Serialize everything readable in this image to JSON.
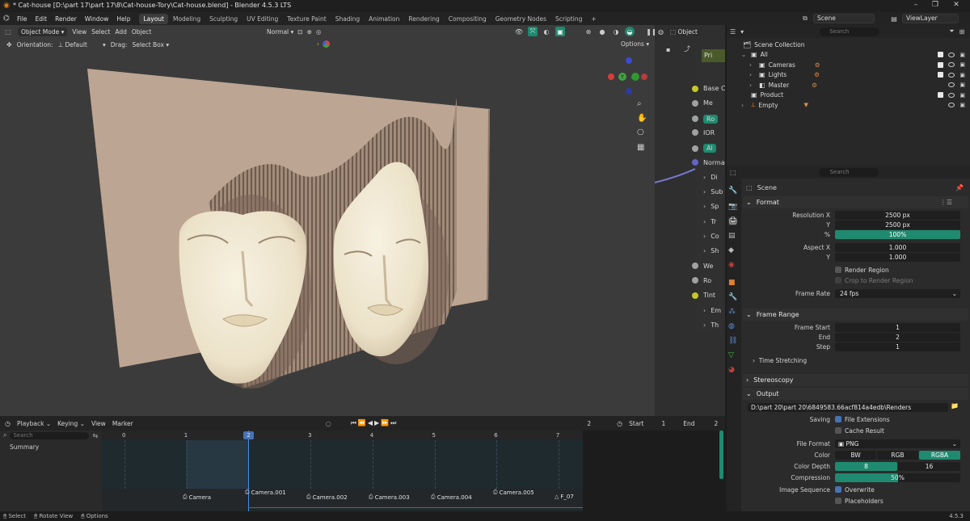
{
  "window": {
    "title": "* Cat-house [D:\\part 17\\part 17\\8\\Cat-house-Tory\\Cat-house.blend] - Blender 4.5.3 LTS",
    "minimize": "–",
    "maximize": "❐",
    "close": "✕"
  },
  "menu": [
    "File",
    "Edit",
    "Render",
    "Window",
    "Help"
  ],
  "workspaces": [
    "Layout",
    "Modeling",
    "Sculpting",
    "UV Editing",
    "Texture Paint",
    "Shading",
    "Animation",
    "Rendering",
    "Compositing",
    "Geometry Nodes",
    "Scripting"
  ],
  "workspace_add": "+",
  "scene": {
    "label": "Scene",
    "view_layer": "ViewLayer"
  },
  "viewport": {
    "mode": "Object Mode",
    "menus": [
      "View",
      "Select",
      "Add",
      "Object"
    ],
    "orientation_label": "Orientation:",
    "orientation_value": "Default",
    "drag_label": "Drag:",
    "drag_value": "Select Box",
    "shading_mode": "Normal",
    "options": "Options"
  },
  "node_editor": {
    "mode": "Object",
    "header_label": "Pri",
    "rows": [
      "Base C",
      "Me",
      "Ro",
      "IOR",
      "Al",
      "Norma",
      "Di",
      "Sub",
      "Sp",
      "Tr",
      "Co",
      "Sh",
      "We",
      "Ro",
      "Tint",
      "Em",
      "Th"
    ]
  },
  "outliner": {
    "search_placeholder": "Search",
    "items": [
      {
        "label": "Scene Collection",
        "indent": 0
      },
      {
        "label": "All",
        "indent": 1
      },
      {
        "label": "Cameras",
        "indent": 2
      },
      {
        "label": "Lights",
        "indent": 2
      },
      {
        "label": "Master",
        "indent": 2
      },
      {
        "label": "Product",
        "indent": 1
      },
      {
        "label": "Empty",
        "indent": 1
      }
    ]
  },
  "properties": {
    "search_placeholder": "Search",
    "context": "Scene",
    "format": {
      "title": "Format",
      "res_x_label": "Resolution X",
      "res_x": "2500 px",
      "res_y_label": "Y",
      "res_y": "2500 px",
      "percent_label": "%",
      "percent": "100%",
      "aspect_x_label": "Aspect X",
      "aspect_x": "1.000",
      "aspect_y_label": "Y",
      "aspect_y": "1.000",
      "render_region": "Render Region",
      "crop_region": "Crop to Render Region",
      "frame_rate_label": "Frame Rate",
      "frame_rate": "24 fps"
    },
    "frame_range": {
      "title": "Frame Range",
      "start_label": "Frame Start",
      "start": "1",
      "end_label": "End",
      "end": "2",
      "step_label": "Step",
      "step": "1",
      "time_stretching": "Time Stretching"
    },
    "stereoscopy": "Stereoscopy",
    "output": {
      "title": "Output",
      "path": "D:\\part 20\\part 20\\6849583.66acf814a4edb\\Renders",
      "saving_label": "Saving",
      "file_extensions": "File Extensions",
      "cache_result": "Cache Result",
      "file_format_label": "File Format",
      "file_format": "PNG",
      "color_label": "Color",
      "color_options": [
        "BW",
        "RGB",
        "RGBA"
      ],
      "depth_label": "Color Depth",
      "depth_options": [
        "8",
        "16"
      ],
      "compression_label": "Compression",
      "compression": "50%",
      "image_sequence_label": "Image Sequence",
      "overwrite": "Overwrite",
      "placeholders": "Placeholders"
    }
  },
  "timeline": {
    "menus": [
      "Playback",
      "Keying",
      "View",
      "Marker"
    ],
    "current_frame": "2",
    "start_label": "Start",
    "start": "1",
    "end_label": "End",
    "end": "2",
    "search_placeholder": "Search",
    "summary": "Summary",
    "ruler": [
      "0",
      "1",
      "2",
      "3",
      "4",
      "5",
      "6",
      "7"
    ],
    "markers": [
      "Camera",
      "Camera.001",
      "Camera.002",
      "Camera.003",
      "Camera.004",
      "Camera.005",
      "F_07"
    ]
  },
  "status": {
    "select": "Select",
    "rotate": "Rotate View",
    "options": "Options",
    "version": "4.5.3"
  },
  "colors": {
    "accent_teal": "#1f8a70",
    "active_blue": "#4772b3",
    "wall": "#bca592",
    "mask": "#efe7d2"
  }
}
